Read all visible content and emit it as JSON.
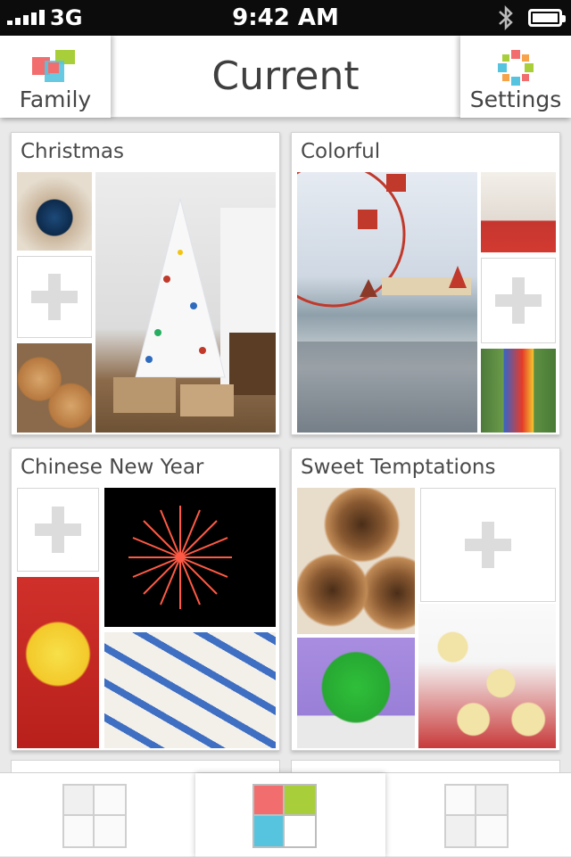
{
  "status_bar": {
    "carrier": "3G",
    "time": "9:42 AM"
  },
  "nav": {
    "title": "Current",
    "left_button": "Family",
    "right_button": "Settings"
  },
  "albums": [
    {
      "title": "Christmas"
    },
    {
      "title": "Colorful"
    },
    {
      "title": "Chinese New Year"
    },
    {
      "title": "Sweet Temptations"
    }
  ],
  "colors": {
    "tab_red": "#f26d6d",
    "tab_green": "#a8cf3a",
    "tab_blue": "#56c4df",
    "tab_white": "#ffffff"
  },
  "tabs": {
    "left_icon": "layout-grid-icon",
    "center_icon": "colored-grid-icon",
    "right_icon": "layout-grid-icon"
  }
}
